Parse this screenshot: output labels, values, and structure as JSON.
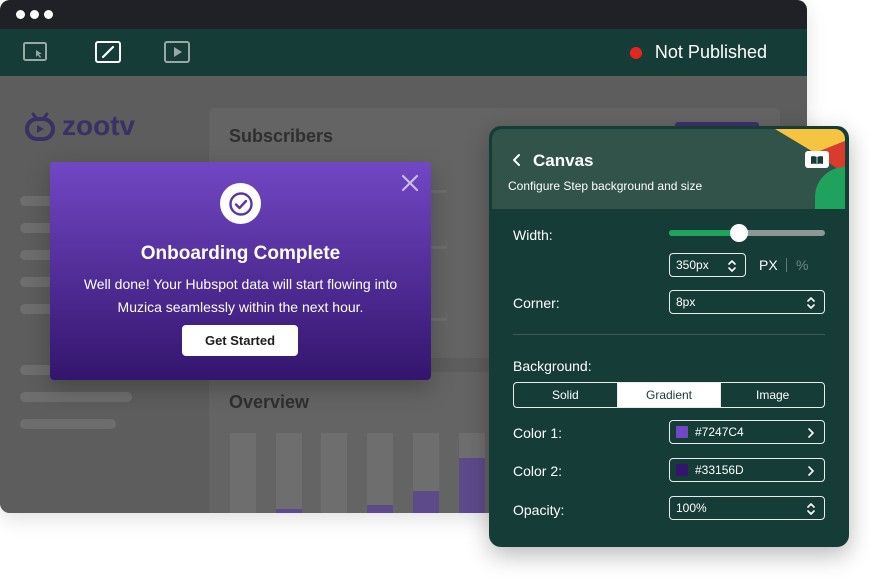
{
  "window": {
    "status_text": "Not Published",
    "toolbar_icons": [
      "select-tool-icon",
      "edit-tool-icon",
      "play-icon"
    ]
  },
  "app": {
    "logo_text": "zootv",
    "subscribers_title": "Subscribers",
    "overview_title": "Overview"
  },
  "modal": {
    "title": "Onboarding Complete",
    "message": "Well done! Your Hubspot data will start flowing into Muzica seamlessly within the next hour.",
    "button_label": "Get Started",
    "gradient_start": "#7247C4",
    "gradient_end": "#33156D"
  },
  "panel": {
    "title": "Canvas",
    "subtitle": "Configure Step background and size",
    "width_label": "Width:",
    "width_value": "350px",
    "width_slider_fraction": 0.45,
    "unit_px": "PX",
    "unit_percent": "%",
    "corner_label": "Corner:",
    "corner_value": "8px",
    "background_label": "Background:",
    "background_options": [
      "Solid",
      "Gradient",
      "Image"
    ],
    "background_selected": "Gradient",
    "color1_label": "Color 1:",
    "color1_value": "#7247C4",
    "color2_label": "Color 2:",
    "color2_value": "#33156D",
    "opacity_label": "Opacity:",
    "opacity_value": "100%",
    "accent_color": "#1fa35c"
  }
}
